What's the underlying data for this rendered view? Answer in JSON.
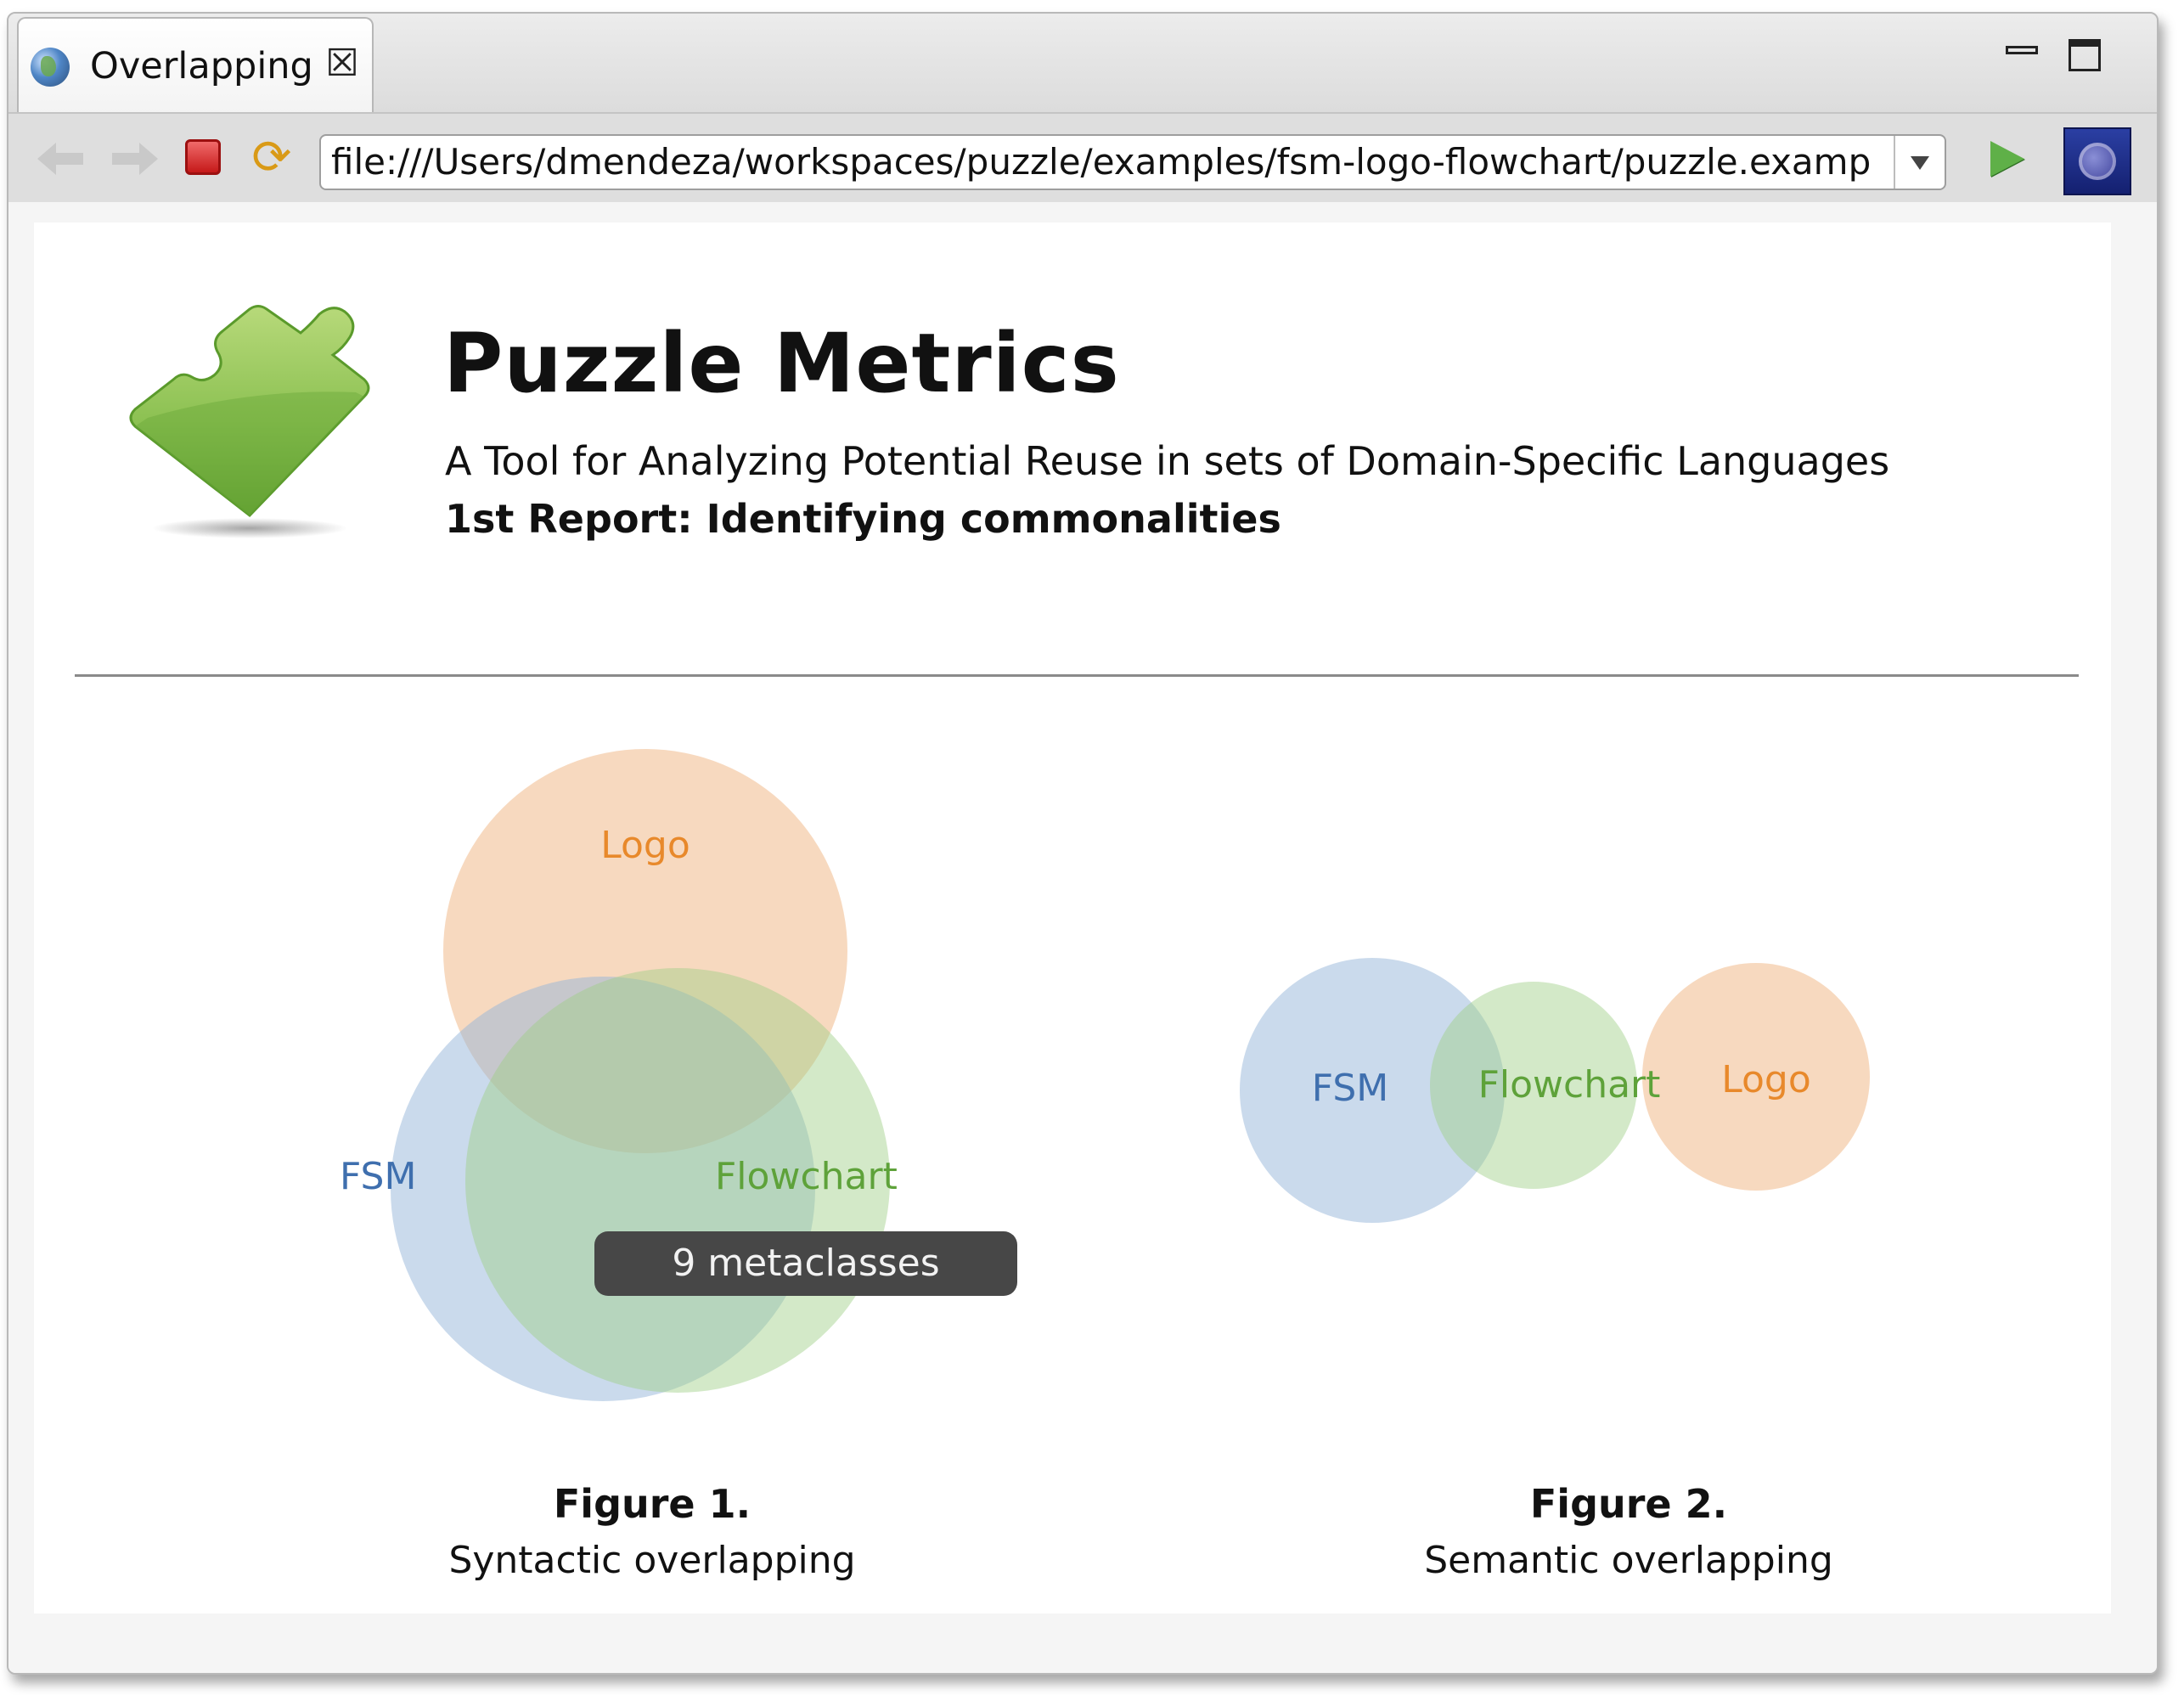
{
  "tab": {
    "title": "Overlapping",
    "icon": "globe-icon"
  },
  "toolbar": {
    "url": "file:///Users/dmendeza/workspaces/puzzle/examples/fsm-logo-flowchart/puzzle.examp"
  },
  "report": {
    "title": "Puzzle Metrics",
    "subtitle": "A Tool for Analyzing Potential Reuse in sets of Domain-Specific Languages",
    "heading": "1st Report: Identifying commonalities"
  },
  "colors": {
    "logo": "#e8892b",
    "fsm": "#3f6fae",
    "flowchart": "#5ea23a",
    "logo_fill": "#f6d8bd",
    "fsm_fill": "#c3d5e8",
    "flowchart_fill": "#c8e2bb"
  },
  "figure1": {
    "labels": {
      "logo": "Logo",
      "fsm": "FSM",
      "flowchart": "Flowchart"
    },
    "tooltip": "9 metaclasses",
    "caption_title": "Figure 1.",
    "caption": "Syntactic overlapping"
  },
  "figure2": {
    "labels": {
      "fsm": "FSM",
      "flowchart": "Flowchart",
      "logo": "Logo"
    },
    "caption_title": "Figure 2.",
    "caption": "Semantic overlapping"
  }
}
